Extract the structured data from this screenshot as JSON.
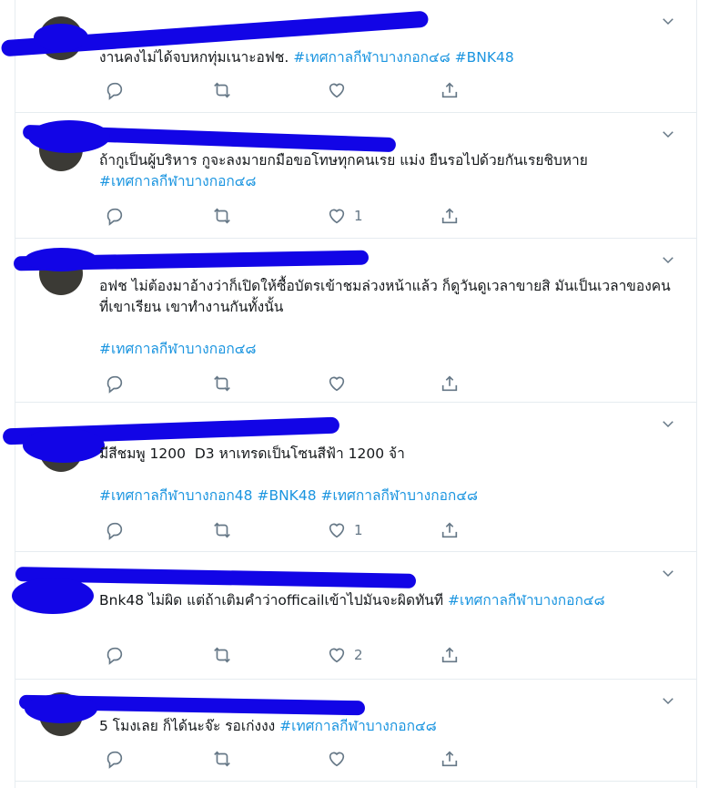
{
  "tweets": [
    {
      "text_plain": "งานคงไม่ได้จบหกทุ่มเนาะอฟช. ",
      "hashtags": [
        "#เทศกาลกีฬาบางกอก๔๘",
        "#BNK48"
      ],
      "reply_count": "",
      "retweet_count": "",
      "like_count": ""
    },
    {
      "text_plain": "ถ้ากูเป็นผู้บริหาร กูจะลงมายกมือขอโทษทุกคนเรย แม่ง ยืนรอไปด้วยกันเรยชิบหาย",
      "hashtags": [
        "#เทศกาลกีฬาบางกอก๔๘"
      ],
      "reply_count": "",
      "retweet_count": "",
      "like_count": "1"
    },
    {
      "text_plain": "อฟช ไม่ต้องมาอ้างว่าก็เปิดให้ซื้อบัตรเข้าชมล่วงหน้าแล้ว ก็ดูวันดูเวลาขายสิ มันเป็นเวลาของคนที่เขาเรียน เขาทำงานกันทั้งนั้น",
      "hashtags": [
        "#เทศกาลกีฬาบางกอก๔๘"
      ],
      "reply_count": "",
      "retweet_count": "",
      "like_count": ""
    },
    {
      "text_plain": "มีสีชมพู 1200  D3 หาเทรดเป็นโซนสีฟ้า 1200 จ้า",
      "hashtags": [
        "#เทศกาลกีฬาบางกอก48",
        "#BNK48",
        "#เทศกาลกีฬาบางกอก๔๘"
      ],
      "reply_count": "",
      "retweet_count": "",
      "like_count": "1"
    },
    {
      "text_plain": "Bnk48 ไม่ผิด แต่ถ้าเติมคำว่าofficailเข้าไปมันจะผิดทันที ",
      "hashtags": [
        "#เทศกาลกีฬาบางกอก๔๘"
      ],
      "reply_count": "",
      "retweet_count": "",
      "like_count": "2"
    },
    {
      "text_plain": "5 โมงเลย ก็ได้นะจ๊ะ รอเก่งงง ",
      "hashtags": [
        "#เทศกาลกีฬาบางกอก๔๘"
      ],
      "reply_count": "",
      "retweet_count": "",
      "like_count": ""
    }
  ],
  "icons": {
    "reply": "reply-icon",
    "retweet": "retweet-icon",
    "like": "heart-icon",
    "share": "share-icon",
    "more": "chevron-down-icon"
  },
  "colors": {
    "hashtag": "#1b95e0",
    "icon": "#657786",
    "redaction": "#1205e6",
    "border": "#e6ecf0"
  }
}
